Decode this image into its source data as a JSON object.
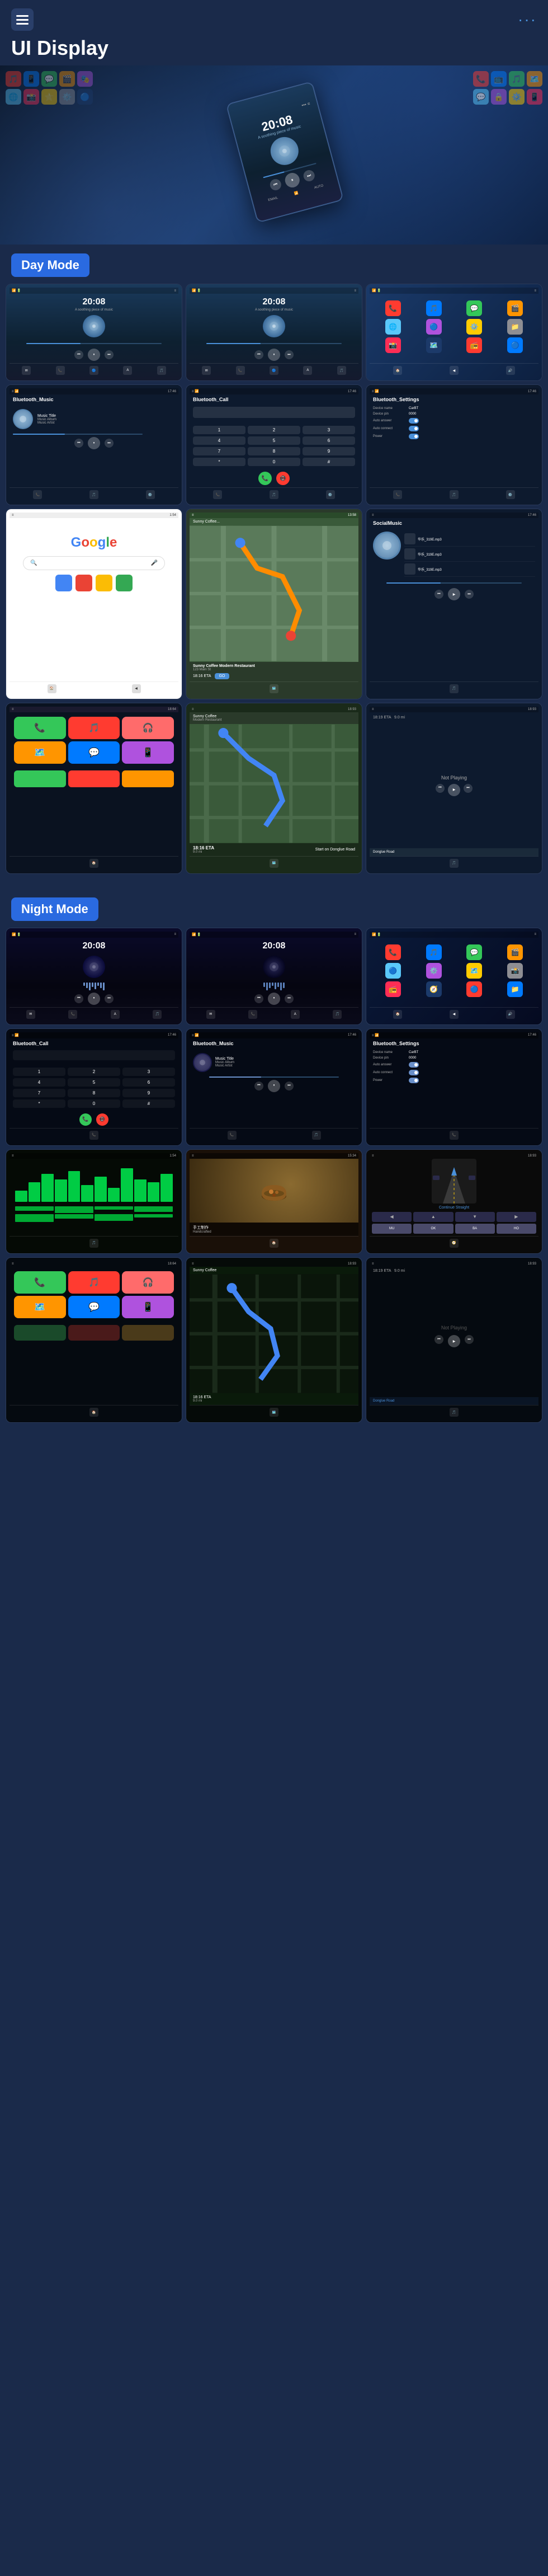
{
  "header": {
    "title": "UI Display",
    "menu_icon": "≡",
    "dots_icon": "···"
  },
  "modes": [
    {
      "id": "day",
      "label": "Day Mode"
    },
    {
      "id": "night",
      "label": "Night Mode"
    }
  ],
  "day_screens": {
    "row1": [
      {
        "type": "music_player",
        "time": "20:08",
        "subtitle": "A soothing piece of music"
      },
      {
        "type": "music_player",
        "time": "20:08",
        "subtitle": "A soothing piece of music"
      },
      {
        "type": "app_launcher"
      }
    ],
    "row2": [
      {
        "type": "bluetooth_music",
        "title": "Bluetooth_Music",
        "track": "Music Title",
        "album": "Music Album",
        "artist": "Music Artist"
      },
      {
        "type": "bluetooth_call",
        "title": "Bluetooth_Call"
      },
      {
        "type": "bluetooth_settings",
        "title": "Bluetooth_Settings",
        "device_name": "CarBT",
        "device_pin": "0000"
      }
    ],
    "row3": [
      {
        "type": "google",
        "title": "Google"
      },
      {
        "type": "map_navigation"
      },
      {
        "type": "social_music",
        "title": "SocialMusic"
      }
    ],
    "row4": [
      {
        "type": "carplay"
      },
      {
        "type": "navigation_full"
      },
      {
        "type": "not_playing"
      }
    ]
  },
  "night_screens": {
    "row1": [
      {
        "type": "music_player_night",
        "time": "20:08"
      },
      {
        "type": "music_player_night",
        "time": "20:08"
      },
      {
        "type": "app_launcher_night"
      }
    ],
    "row2": [
      {
        "type": "bluetooth_call_night",
        "title": "Bluetooth_Call"
      },
      {
        "type": "bluetooth_music_night",
        "title": "Bluetooth_Music",
        "track": "Music Title",
        "album": "Music Album",
        "artist": "Music Artist"
      },
      {
        "type": "bluetooth_settings_night",
        "title": "Bluetooth_Settings",
        "device_name": "CarBT",
        "device_pin": "0000"
      }
    ],
    "row3": [
      {
        "type": "wave_viz"
      },
      {
        "type": "food_image"
      },
      {
        "type": "steering_nav"
      }
    ],
    "row4": [
      {
        "type": "carplay_night"
      },
      {
        "type": "navigation_night"
      },
      {
        "type": "not_playing_night"
      }
    ]
  },
  "labels": {
    "music_title": "Music Title",
    "music_album": "Music Album",
    "music_artist": "Music Artist",
    "bluetooth_music": "Bluetooth_Music",
    "bluetooth_call": "Bluetooth_Call",
    "bluetooth_settings": "Bluetooth_Settings",
    "device_name_label": "Device name",
    "device_name_value": "CarBT",
    "device_pin_label": "Device pin",
    "device_pin_value": "0000",
    "auto_answer": "Auto answer",
    "auto_connect": "Auto connect",
    "power": "Power",
    "social_music": "SocialMusic",
    "google": "Google",
    "go_btn": "GO",
    "not_playing": "Not Playing",
    "sunny_coffee": "Sunny Coffee",
    "modern_restaurant": "Modern Restaurant",
    "nav_time": "18:16 ETA",
    "nav_distance": "9.0 mi",
    "nav_route": "Start on Donglue Road",
    "nav_destination": "Donglue Road"
  },
  "app_icons": [
    {
      "color": "#ff2d55",
      "emoji": "📞"
    },
    {
      "color": "#ff3b30",
      "emoji": "🎵"
    },
    {
      "color": "#007aff",
      "emoji": "📱"
    },
    {
      "color": "#34c759",
      "emoji": "💬"
    },
    {
      "color": "#ff9500",
      "emoji": "📺"
    },
    {
      "color": "#5ac8fa",
      "emoji": "🌐"
    },
    {
      "color": "#af52de",
      "emoji": "🎭"
    },
    {
      "color": "#1c3a6a",
      "emoji": "🔵"
    }
  ],
  "tracks": [
    {
      "name": "华乐_319E.mp3"
    },
    {
      "name": "华乐_319E.mp3"
    },
    {
      "name": "华乐_319E.mp3"
    }
  ]
}
